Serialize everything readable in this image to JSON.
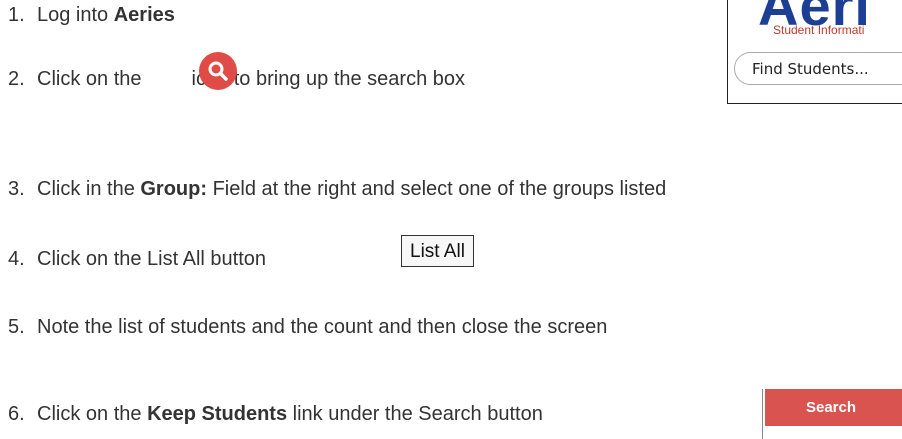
{
  "steps": [
    {
      "num": "1.",
      "pre": "Log into ",
      "bold": "Aeries",
      "post": ""
    },
    {
      "num": "2.",
      "pre": "Click on the",
      "post": "icon to bring up the search box"
    },
    {
      "num": "3.",
      "pre": "Click in the ",
      "bold": "Group:",
      "post": " Field at the right and select one of the groups listed"
    },
    {
      "num": "4.",
      "pre": "Click on the List All button"
    },
    {
      "num": "5.",
      "pre": "Note the list of students and the count and then close the screen"
    },
    {
      "num": "6.",
      "pre": "Click on the ",
      "bold": "Keep Students",
      "post": " link under the Search button"
    }
  ],
  "icons": {
    "search": "search-icon"
  },
  "colors": {
    "search_icon_bg": "#e04a47",
    "aeries_blue": "#1c3f95",
    "search_button_bg": "#d9534f"
  },
  "list_all_button": {
    "label": "List All"
  },
  "aeries_logo": {
    "word": "Aeri",
    "subtitle": "Student Informati"
  },
  "find_students": {
    "placeholder": "Find Students..."
  },
  "search_button": {
    "label": "Search"
  }
}
